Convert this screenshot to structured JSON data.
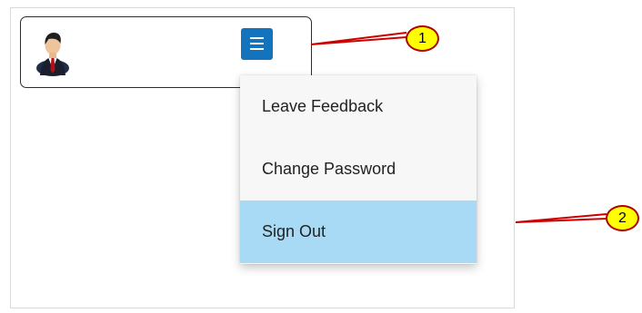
{
  "user_panel": {
    "avatar_icon": "business-user-avatar-icon",
    "menu_icon": "hamburger-menu-icon",
    "menu_button_color": "#1374bd"
  },
  "dropdown": {
    "items": [
      {
        "label": "Leave Feedback"
      },
      {
        "label": "Change Password"
      },
      {
        "label": "Sign Out",
        "highlighted": true
      }
    ],
    "background": "#f7f7f7",
    "highlight_color": "#a9daf5"
  },
  "callouts": [
    {
      "label": "1"
    },
    {
      "label": "2"
    }
  ],
  "colors": {
    "callout_fill": "#ffff00",
    "callout_border": "#b30000",
    "callout_line": "#cc0000"
  }
}
